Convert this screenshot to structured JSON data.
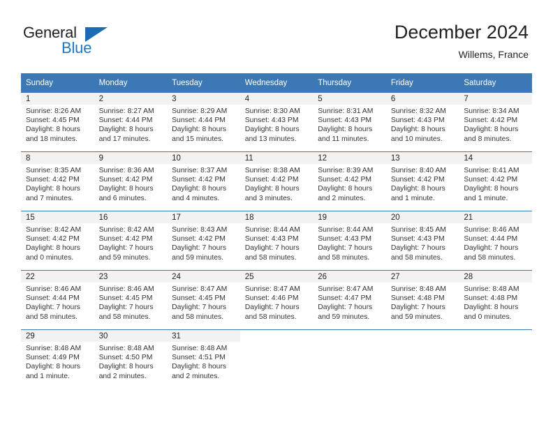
{
  "brand": {
    "name_part1": "General",
    "name_part2": "Blue",
    "triangle_color": "#1b6cb4",
    "blue_color": "#1b78c8"
  },
  "header": {
    "title": "December 2024",
    "subtitle": "Willems, France",
    "accent_color": "#3b78b4",
    "daynum_band_color": "#f2f2f2"
  },
  "weekdays": [
    "Sunday",
    "Monday",
    "Tuesday",
    "Wednesday",
    "Thursday",
    "Friday",
    "Saturday"
  ],
  "weeks": [
    [
      {
        "day": "1",
        "sunrise": "Sunrise: 8:26 AM",
        "sunset": "Sunset: 4:45 PM",
        "daylight1": "Daylight: 8 hours",
        "daylight2": "and 18 minutes."
      },
      {
        "day": "2",
        "sunrise": "Sunrise: 8:27 AM",
        "sunset": "Sunset: 4:44 PM",
        "daylight1": "Daylight: 8 hours",
        "daylight2": "and 17 minutes."
      },
      {
        "day": "3",
        "sunrise": "Sunrise: 8:29 AM",
        "sunset": "Sunset: 4:44 PM",
        "daylight1": "Daylight: 8 hours",
        "daylight2": "and 15 minutes."
      },
      {
        "day": "4",
        "sunrise": "Sunrise: 8:30 AM",
        "sunset": "Sunset: 4:43 PM",
        "daylight1": "Daylight: 8 hours",
        "daylight2": "and 13 minutes."
      },
      {
        "day": "5",
        "sunrise": "Sunrise: 8:31 AM",
        "sunset": "Sunset: 4:43 PM",
        "daylight1": "Daylight: 8 hours",
        "daylight2": "and 11 minutes."
      },
      {
        "day": "6",
        "sunrise": "Sunrise: 8:32 AM",
        "sunset": "Sunset: 4:43 PM",
        "daylight1": "Daylight: 8 hours",
        "daylight2": "and 10 minutes."
      },
      {
        "day": "7",
        "sunrise": "Sunrise: 8:34 AM",
        "sunset": "Sunset: 4:42 PM",
        "daylight1": "Daylight: 8 hours",
        "daylight2": "and 8 minutes."
      }
    ],
    [
      {
        "day": "8",
        "sunrise": "Sunrise: 8:35 AM",
        "sunset": "Sunset: 4:42 PM",
        "daylight1": "Daylight: 8 hours",
        "daylight2": "and 7 minutes."
      },
      {
        "day": "9",
        "sunrise": "Sunrise: 8:36 AM",
        "sunset": "Sunset: 4:42 PM",
        "daylight1": "Daylight: 8 hours",
        "daylight2": "and 6 minutes."
      },
      {
        "day": "10",
        "sunrise": "Sunrise: 8:37 AM",
        "sunset": "Sunset: 4:42 PM",
        "daylight1": "Daylight: 8 hours",
        "daylight2": "and 4 minutes."
      },
      {
        "day": "11",
        "sunrise": "Sunrise: 8:38 AM",
        "sunset": "Sunset: 4:42 PM",
        "daylight1": "Daylight: 8 hours",
        "daylight2": "and 3 minutes."
      },
      {
        "day": "12",
        "sunrise": "Sunrise: 8:39 AM",
        "sunset": "Sunset: 4:42 PM",
        "daylight1": "Daylight: 8 hours",
        "daylight2": "and 2 minutes."
      },
      {
        "day": "13",
        "sunrise": "Sunrise: 8:40 AM",
        "sunset": "Sunset: 4:42 PM",
        "daylight1": "Daylight: 8 hours",
        "daylight2": "and 1 minute."
      },
      {
        "day": "14",
        "sunrise": "Sunrise: 8:41 AM",
        "sunset": "Sunset: 4:42 PM",
        "daylight1": "Daylight: 8 hours",
        "daylight2": "and 1 minute."
      }
    ],
    [
      {
        "day": "15",
        "sunrise": "Sunrise: 8:42 AM",
        "sunset": "Sunset: 4:42 PM",
        "daylight1": "Daylight: 8 hours",
        "daylight2": "and 0 minutes."
      },
      {
        "day": "16",
        "sunrise": "Sunrise: 8:42 AM",
        "sunset": "Sunset: 4:42 PM",
        "daylight1": "Daylight: 7 hours",
        "daylight2": "and 59 minutes."
      },
      {
        "day": "17",
        "sunrise": "Sunrise: 8:43 AM",
        "sunset": "Sunset: 4:42 PM",
        "daylight1": "Daylight: 7 hours",
        "daylight2": "and 59 minutes."
      },
      {
        "day": "18",
        "sunrise": "Sunrise: 8:44 AM",
        "sunset": "Sunset: 4:43 PM",
        "daylight1": "Daylight: 7 hours",
        "daylight2": "and 58 minutes."
      },
      {
        "day": "19",
        "sunrise": "Sunrise: 8:44 AM",
        "sunset": "Sunset: 4:43 PM",
        "daylight1": "Daylight: 7 hours",
        "daylight2": "and 58 minutes."
      },
      {
        "day": "20",
        "sunrise": "Sunrise: 8:45 AM",
        "sunset": "Sunset: 4:43 PM",
        "daylight1": "Daylight: 7 hours",
        "daylight2": "and 58 minutes."
      },
      {
        "day": "21",
        "sunrise": "Sunrise: 8:46 AM",
        "sunset": "Sunset: 4:44 PM",
        "daylight1": "Daylight: 7 hours",
        "daylight2": "and 58 minutes."
      }
    ],
    [
      {
        "day": "22",
        "sunrise": "Sunrise: 8:46 AM",
        "sunset": "Sunset: 4:44 PM",
        "daylight1": "Daylight: 7 hours",
        "daylight2": "and 58 minutes."
      },
      {
        "day": "23",
        "sunrise": "Sunrise: 8:46 AM",
        "sunset": "Sunset: 4:45 PM",
        "daylight1": "Daylight: 7 hours",
        "daylight2": "and 58 minutes."
      },
      {
        "day": "24",
        "sunrise": "Sunrise: 8:47 AM",
        "sunset": "Sunset: 4:45 PM",
        "daylight1": "Daylight: 7 hours",
        "daylight2": "and 58 minutes."
      },
      {
        "day": "25",
        "sunrise": "Sunrise: 8:47 AM",
        "sunset": "Sunset: 4:46 PM",
        "daylight1": "Daylight: 7 hours",
        "daylight2": "and 58 minutes."
      },
      {
        "day": "26",
        "sunrise": "Sunrise: 8:47 AM",
        "sunset": "Sunset: 4:47 PM",
        "daylight1": "Daylight: 7 hours",
        "daylight2": "and 59 minutes."
      },
      {
        "day": "27",
        "sunrise": "Sunrise: 8:48 AM",
        "sunset": "Sunset: 4:48 PM",
        "daylight1": "Daylight: 7 hours",
        "daylight2": "and 59 minutes."
      },
      {
        "day": "28",
        "sunrise": "Sunrise: 8:48 AM",
        "sunset": "Sunset: 4:48 PM",
        "daylight1": "Daylight: 8 hours",
        "daylight2": "and 0 minutes."
      }
    ],
    [
      {
        "day": "29",
        "sunrise": "Sunrise: 8:48 AM",
        "sunset": "Sunset: 4:49 PM",
        "daylight1": "Daylight: 8 hours",
        "daylight2": "and 1 minute."
      },
      {
        "day": "30",
        "sunrise": "Sunrise: 8:48 AM",
        "sunset": "Sunset: 4:50 PM",
        "daylight1": "Daylight: 8 hours",
        "daylight2": "and 2 minutes."
      },
      {
        "day": "31",
        "sunrise": "Sunrise: 8:48 AM",
        "sunset": "Sunset: 4:51 PM",
        "daylight1": "Daylight: 8 hours",
        "daylight2": "and 2 minutes."
      },
      {
        "day": "",
        "sunrise": "",
        "sunset": "",
        "daylight1": "",
        "daylight2": ""
      },
      {
        "day": "",
        "sunrise": "",
        "sunset": "",
        "daylight1": "",
        "daylight2": ""
      },
      {
        "day": "",
        "sunrise": "",
        "sunset": "",
        "daylight1": "",
        "daylight2": ""
      },
      {
        "day": "",
        "sunrise": "",
        "sunset": "",
        "daylight1": "",
        "daylight2": ""
      }
    ]
  ]
}
